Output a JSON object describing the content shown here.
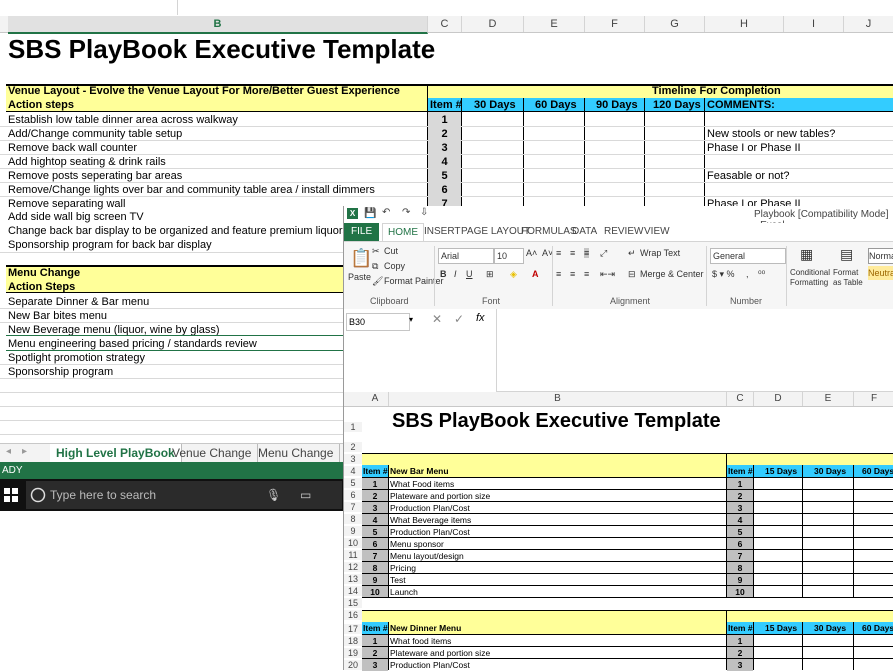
{
  "back_window": {
    "columns": [
      "B",
      "C",
      "D",
      "E",
      "F",
      "G",
      "H",
      "I",
      "J"
    ],
    "title": "SBS PlayBook Executive Template",
    "section1_header": "Venue Layout - Evolve the Venue Layout For More/Better Guest Experience",
    "timeline_header": "Timeline For Completion",
    "action_steps_label": "Action steps",
    "table_headers": [
      "Item #",
      "30 Days",
      "60 Days",
      "90 Days",
      "120 Days",
      "COMMENTS:"
    ],
    "venue_rows": [
      {
        "text": "Establish low table dinner area across walkway",
        "item": "1",
        "comment": ""
      },
      {
        "text": "Add/Change community table setup",
        "item": "2",
        "comment": "New stools or new tables?"
      },
      {
        "text": "Remove back wall counter",
        "item": "3",
        "comment": "Phase I or Phase II"
      },
      {
        "text": "Add hightop seating & drink rails",
        "item": "4",
        "comment": ""
      },
      {
        "text": "Remove posts seperating bar areas",
        "item": "5",
        "comment": "Feasable or not?"
      },
      {
        "text": "Remove/Change lights over bar and community table area / install dimmers",
        "item": "6",
        "comment": ""
      },
      {
        "text": "Remove separating wall",
        "item": "7",
        "comment": "Phase I or Phase II"
      },
      {
        "text": "Add side wall big screen TV",
        "item": "",
        "comment": ""
      },
      {
        "text": "Change back bar display to be organized and feature premium liquors",
        "item": "",
        "comment": ""
      },
      {
        "text": "Sponsorship program for back bar display",
        "item": "",
        "comment": ""
      }
    ],
    "section2_header": "Menu Change",
    "action_steps_label2": "Action Steps",
    "menu_rows": [
      "Separate Dinner & Bar menu",
      "New Bar bites menu",
      "New Beverage menu (liquor, wine by glass)",
      "Menu engineering based pricing / standards review",
      "Spotlight promotion strategy",
      "Sponsorship program"
    ],
    "sheet_tabs": [
      "High Level PlayBook",
      "Venue Change",
      "Menu Change"
    ],
    "status_text": "ADY",
    "taskbar_search": "Type here to search"
  },
  "front_window": {
    "window_title": "Playbook  [Compatibility Mode] - Excel",
    "ribbon_tabs": [
      "FILE",
      "HOME",
      "INSERT",
      "PAGE LAYOUT",
      "FORMULAS",
      "DATA",
      "REVIEW",
      "VIEW"
    ],
    "clipboard": {
      "paste": "Paste",
      "cut": "Cut",
      "copy": "Copy",
      "format_painter": "Format Painter",
      "label": "Clipboard"
    },
    "font": {
      "name": "Arial",
      "size": "10",
      "label": "Font"
    },
    "alignment": {
      "wrap": "Wrap Text",
      "merge": "Merge & Center",
      "label": "Alignment"
    },
    "number": {
      "format": "General",
      "label": "Number"
    },
    "styles": {
      "conditional": "Conditional Formatting",
      "format_as": "Format as Table",
      "normal": "Norma",
      "neutral": "Neutra"
    },
    "name_box": "B30",
    "columns": [
      "A",
      "B",
      "C",
      "D",
      "E",
      "F"
    ],
    "title": "SBS PlayBook Executive Template",
    "table1": {
      "headers": [
        "Item #",
        "New Bar Menu",
        "Item #",
        "15 Days",
        "30 Days",
        "60 Days"
      ],
      "rows": [
        {
          "n": "1",
          "text": "What Food items"
        },
        {
          "n": "2",
          "text": "Plateware and portion size"
        },
        {
          "n": "3",
          "text": "Production Plan/Cost"
        },
        {
          "n": "4",
          "text": "What Beverage items"
        },
        {
          "n": "5",
          "text": "Production Plan/Cost"
        },
        {
          "n": "6",
          "text": "Menu sponsor"
        },
        {
          "n": "7",
          "text": "Menu layout/design"
        },
        {
          "n": "8",
          "text": "Pricing"
        },
        {
          "n": "9",
          "text": "Test"
        },
        {
          "n": "10",
          "text": "Launch"
        }
      ]
    },
    "table2": {
      "headers": [
        "Item #",
        "New Dinner Menu",
        "Item #",
        "15 Days",
        "30 Days",
        "60 Days"
      ],
      "rows": [
        {
          "n": "1",
          "text": "What food items"
        },
        {
          "n": "2",
          "text": "Plateware and portion size"
        },
        {
          "n": "3",
          "text": "Production Plan/Cost"
        }
      ]
    },
    "row_numbers": [
      "1",
      "2",
      "3",
      "4",
      "5",
      "6",
      "7",
      "8",
      "9",
      "10",
      "11",
      "12",
      "13",
      "14",
      "15",
      "16",
      "17",
      "18",
      "19",
      "20"
    ]
  }
}
